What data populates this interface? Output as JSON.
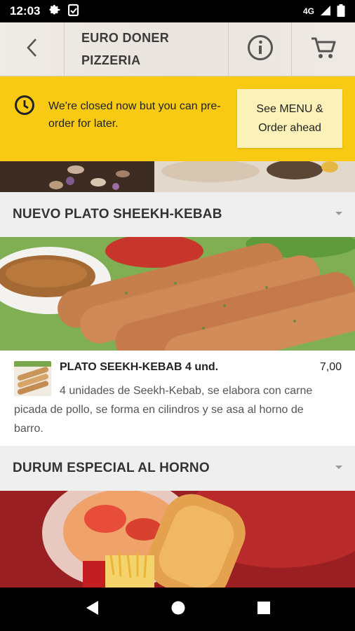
{
  "status_bar": {
    "time": "12:03",
    "network": "4G",
    "icons": [
      "settings-icon",
      "clipboard-icon",
      "signal-icon",
      "battery-icon"
    ]
  },
  "app_bar": {
    "title": "EURO DONER\nPIZZERIA",
    "icons": [
      "back-icon",
      "info-icon",
      "cart-icon"
    ]
  },
  "closed_banner": {
    "message": "We're closed now but you can pre-order for later.",
    "button_label": "See MENU &\nOrder ahead",
    "icon": "clock-icon",
    "colors": {
      "banner": "#f8ca14",
      "button": "#fcf1b8"
    }
  },
  "sections": [
    {
      "title": "NUEVO PLATO SHEEKH-KEBAB",
      "items": [
        {
          "name": "PLATO SEEKH-KEBAB 4 und.",
          "price": "7,00",
          "description": "4 unidades de Seekh-Kebab, se elabora con carne picada de pollo, se forma en cilindros y se asa al horno de barro."
        }
      ]
    },
    {
      "title": "DURUM ESPECIAL AL HORNO",
      "items": []
    }
  ],
  "nav_bar": {
    "icons": [
      "nav-back-icon",
      "nav-home-icon",
      "nav-recents-icon"
    ]
  }
}
